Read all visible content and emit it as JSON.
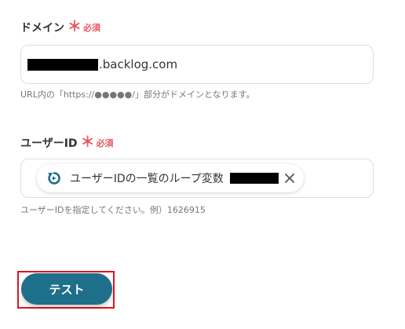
{
  "domain_field": {
    "label": "ドメイン",
    "required_mark": "＊",
    "required_text": "必須",
    "value_suffix": ".backlog.com",
    "hint": "URL内の「https://●●●●●/」部分がドメインとなります。"
  },
  "userid_field": {
    "label": "ユーザーID",
    "required_mark": "＊",
    "required_text": "必須",
    "chip_label": "ユーザーIDの一覧のループ変数",
    "hint": "ユーザーIDを指定してください。例）1626915"
  },
  "actions": {
    "test_label": "テスト"
  },
  "icons": {
    "chip_icon": "loop-icon",
    "chip_remove": "close-icon"
  },
  "colors": {
    "required": "#e8585e",
    "loop_icon": "#1d6f8a",
    "test_button": "#1d6f8a",
    "highlight_outline": "#e3141b"
  }
}
